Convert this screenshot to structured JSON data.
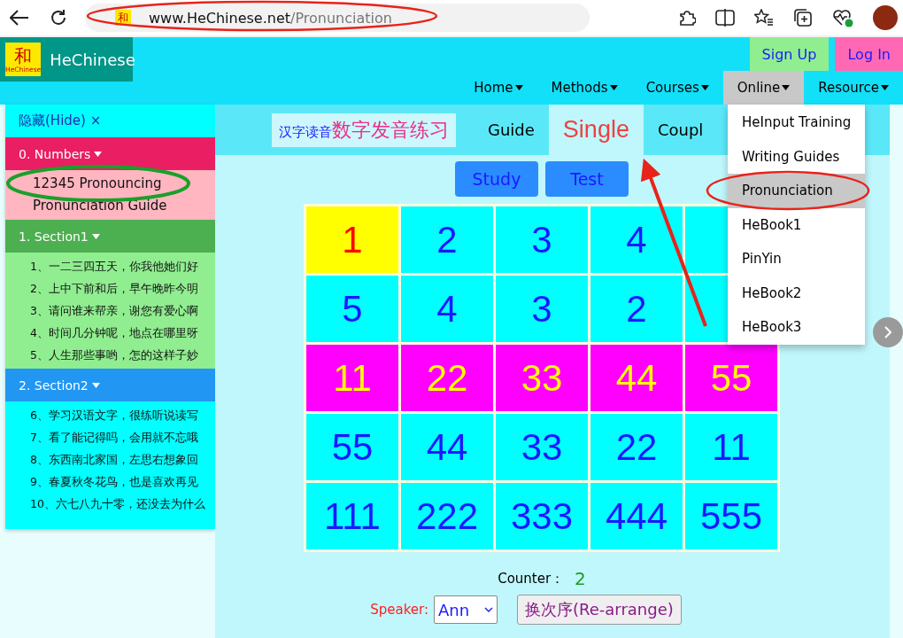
{
  "browser": {
    "favicon_mark": "和",
    "url_host": "www.HeChinese.net",
    "url_path": "/Pronunciation"
  },
  "header": {
    "logo_mark": "和",
    "logo_caption": "HeChinese",
    "site_name": "HeChinese",
    "auth": [
      {
        "label": "Sign Up",
        "kind": "signup"
      },
      {
        "label": "Log In",
        "kind": "login"
      }
    ],
    "nav": [
      {
        "label": "Home",
        "selected": false
      },
      {
        "label": "Methods",
        "selected": false
      },
      {
        "label": "Courses",
        "selected": false
      },
      {
        "label": "Online",
        "selected": true
      },
      {
        "label": "Resource",
        "selected": false
      }
    ]
  },
  "sidebar": {
    "hide_label": "隐藏(Hide) ×",
    "sections": [
      {
        "title": "0. Numbers",
        "color": "#e91e63",
        "kind": "numbers",
        "items": [
          "12345 Pronouncing",
          "Pronunciation Guide"
        ]
      },
      {
        "title": "1. Section1",
        "color": "#4caf50",
        "kind": "lessons",
        "items": [
          "1、一二三四五天，你我他她们好",
          "2、上中下前和后，早午晚昨今明",
          "3、请问谁来帮亲，谢您有爱心啊",
          "4、时间几分钟呢，地点在哪里呀",
          "5、人生那些事哟，怎的这样子妙"
        ]
      },
      {
        "title": "2. Section2",
        "color": "#2196f3",
        "kind": "review",
        "items": [
          "6、学习汉语文字，很练听说读写",
          "7、看了能记得吗，会用就不忘哦",
          "8、东西南北家国，左思右想象回",
          "9、春夏秋冬花鸟，也是喜欢再见",
          "10、六七八九十零，还没去为什么"
        ]
      }
    ]
  },
  "practice": {
    "title_plain": "汉字读音",
    "title_accent": "数字发音练习",
    "tabs": [
      {
        "label": "Guide",
        "selected": false
      },
      {
        "label": "Single",
        "selected": true
      },
      {
        "label": "Coupl",
        "selected": false
      }
    ],
    "mode_buttons": [
      "Study",
      "Test"
    ],
    "grid": [
      {
        "kind": "plain",
        "cells": [
          {
            "text": "1",
            "selected": true
          },
          {
            "text": "2",
            "selected": false
          },
          {
            "text": "3",
            "selected": false
          },
          {
            "text": "4",
            "selected": false
          },
          {
            "selected": false
          }
        ]
      },
      {
        "kind": "plain",
        "cells": [
          {
            "text": "5",
            "selected": false
          },
          {
            "text": "4",
            "selected": false
          },
          {
            "text": "3",
            "selected": false
          },
          {
            "text": "2",
            "selected": false
          },
          {
            "selected": false
          }
        ]
      },
      {
        "kind": "accent",
        "cells": [
          {
            "text": "11",
            "selected": false
          },
          {
            "text": "22",
            "selected": false
          },
          {
            "text": "33",
            "selected": false
          },
          {
            "text": "44",
            "selected": false
          },
          {
            "text": "55",
            "selected": false
          }
        ]
      },
      {
        "kind": "plain",
        "cells": [
          {
            "text": "55",
            "selected": false
          },
          {
            "text": "44",
            "selected": false
          },
          {
            "text": "33",
            "selected": false
          },
          {
            "text": "22",
            "selected": false
          },
          {
            "text": "11",
            "selected": false
          }
        ]
      },
      {
        "kind": "plain",
        "cells": [
          {
            "text": "111",
            "selected": false
          },
          {
            "text": "222",
            "selected": false
          },
          {
            "text": "333",
            "selected": false
          },
          {
            "text": "444",
            "selected": false
          },
          {
            "text": "555",
            "selected": false
          }
        ]
      }
    ],
    "counter_label": "Counter：",
    "counter_value": "2",
    "speaker_label": "Speaker:",
    "speaker_value": "Ann",
    "rearrange_button": "换次序(Re-arrange)"
  },
  "dropdown": [
    {
      "label": "HeInput Training",
      "selected": false
    },
    {
      "label": "Writing Guides",
      "selected": false
    },
    {
      "label": "Pronunciation",
      "selected": true
    },
    {
      "label": "HeBook1",
      "selected": false
    },
    {
      "label": "PinYin",
      "selected": false
    },
    {
      "label": "HeBook2",
      "selected": false
    },
    {
      "label": "HeBook3",
      "selected": false
    }
  ]
}
